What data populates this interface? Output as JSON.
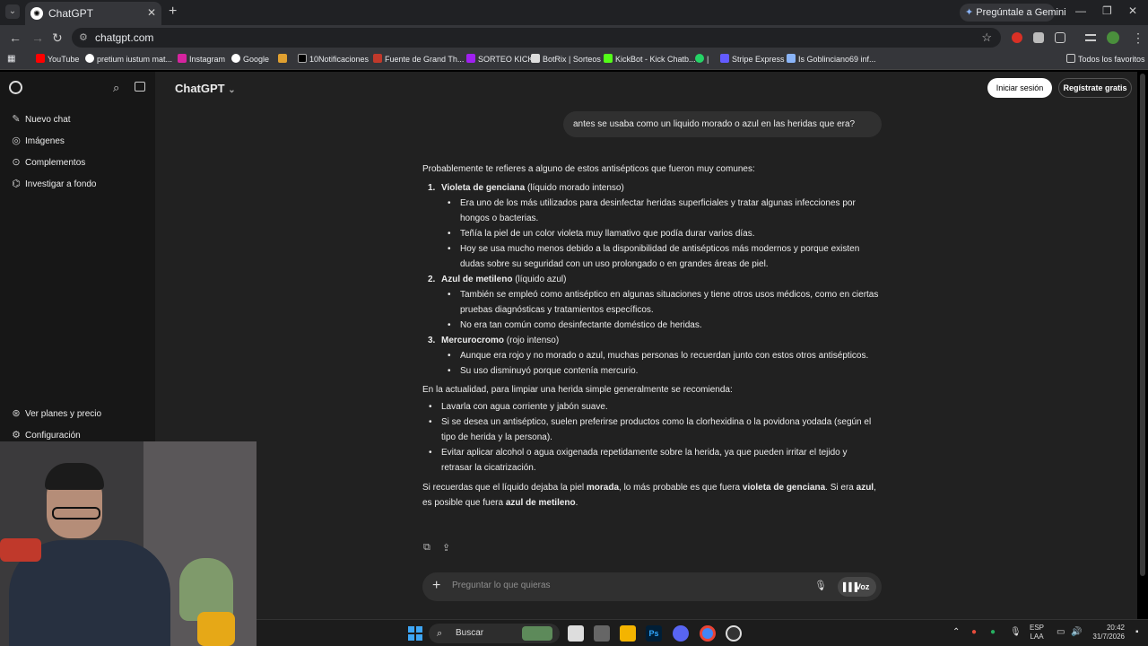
{
  "browser": {
    "tab_title": "ChatGPT",
    "url": "chatgpt.com",
    "gemini_label": "Pregúntale a Gemini",
    "bookmarks": [
      "YouTube",
      "pretium iustum mat...",
      "Instagram",
      "Google",
      "",
      "10Notificaciones",
      "Fuente de Grand Th...",
      "SORTEO KICK",
      "BotRix | Sorteos",
      "KickBot - Kick Chatb...",
      "|",
      "Stripe Express",
      "Is Goblinciano69 inf..."
    ],
    "all_bookmarks": "Todos los favoritos"
  },
  "sidebar": {
    "items": [
      {
        "label": "Nuevo chat",
        "icon": "new-chat-icon"
      },
      {
        "label": "Imágenes",
        "icon": "images-icon"
      },
      {
        "label": "Complementos",
        "icon": "apps-icon"
      },
      {
        "label": "Investigar a fondo",
        "icon": "research-icon"
      }
    ],
    "bottom_items": [
      {
        "label": "Ver planes y precio",
        "icon": "plans-icon"
      },
      {
        "label": "Configuración",
        "icon": "settings-icon"
      }
    ]
  },
  "header": {
    "model": "ChatGPT",
    "login": "Iniciar sesión",
    "register": "Regístrate gratis"
  },
  "conversation": {
    "user_message": "antes  se usaba como un liquido morado o azul en las heridas que era?",
    "intro": "Probablemente te refieres a alguno de estos antisépticos que fueron muy comunes:",
    "options": [
      {
        "num": "1.",
        "name": "Violeta de genciana",
        "desc": " (líquido morado intenso)",
        "bullets": [
          "Era uno de los más utilizados para desinfectar heridas superficiales y tratar algunas infecciones por hongos o bacterias.",
          "Teñía la piel de un color violeta muy llamativo que podía durar varios días.",
          "Hoy se usa mucho menos debido a la disponibilidad de antisépticos más modernos y porque existen dudas sobre su seguridad con un uso prolongado o en grandes áreas de piel."
        ]
      },
      {
        "num": "2.",
        "name": "Azul de metileno",
        "desc": " (líquido azul)",
        "bullets": [
          "También se empleó como antiséptico en algunas situaciones y tiene otros usos médicos, como en ciertas pruebas diagnósticas y tratamientos específicos.",
          "No era tan común como desinfectante doméstico de heridas."
        ]
      },
      {
        "num": "3.",
        "name": "Mercurocromo",
        "desc": " (rojo intenso)",
        "bullets": [
          "Aunque era rojo y no morado o azul, muchas personas lo recuerdan junto con estos otros antisépticos.",
          "Su uso disminuyó porque contenía mercurio."
        ]
      }
    ],
    "today_intro": "En la actualidad, para limpiar una herida simple generalmente se recomienda:",
    "today_bullets": [
      "Lavarla con agua corriente y jabón suave.",
      "Si se desea un antiséptico, suelen preferirse productos como la clorhexidina o la povidona yodada (según el tipo de herida y la persona).",
      "Evitar aplicar alcohol o agua oxigenada repetidamente sobre la herida, ya que pueden irritar el tejido y retrasar la cicatrización."
    ],
    "closing": {
      "t1": "Si recuerdas que el líquido dejaba la piel ",
      "b1": "morada",
      "t2": ", lo más probable es que fuera ",
      "b2": "violeta de genciana",
      "t3": ". Si era ",
      "b3": "azul",
      "t4": ", es posible que fuera ",
      "b4": "azul de metileno",
      "t5": "."
    }
  },
  "composer": {
    "placeholder": "Preguntar lo que quieras",
    "voice": "Voz"
  },
  "taskbar": {
    "search": "Buscar",
    "lang1": "ESP",
    "lang2": "LAA",
    "time": "20:42",
    "date": "31/7/2026"
  }
}
